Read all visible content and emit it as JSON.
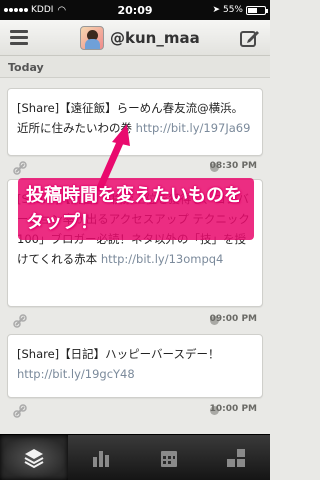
{
  "status_bar": {
    "carrier": "KDDI",
    "time": "20:09",
    "battery": "55%"
  },
  "nav": {
    "title": "@kun_maa",
    "left_icon": "menu-icon",
    "right_icon": "compose-icon"
  },
  "section": {
    "label": "Today"
  },
  "posts": [
    {
      "text": "[Share]【遠征飯】らーめん春友流@横浜。近所に住みたいわの巻 ",
      "link": "http://bit.ly/197Ja69",
      "time": "08:30 PM"
    },
    {
      "text": "[Share]【読書】「検索上位を獲得し、コンバージョン率が出るアクセスアップ テクニック100」ブロガー必読！ネタ以外の「技」を授けてくれる赤本 ",
      "link": "http://bit.ly/13ompq4",
      "time": "09:00 PM"
    },
    {
      "text": "[Share]【日記】ハッピーバースデー！",
      "link": "http://bit.ly/19gcY48",
      "time": "10:00 PM"
    }
  ],
  "annotation": {
    "text": "投稿時間を変えたいものをタップ！",
    "color": "#e90a6e"
  },
  "tabs": [
    {
      "icon": "layers-icon",
      "active": true
    },
    {
      "icon": "bar-chart-icon",
      "active": false
    },
    {
      "icon": "calendar-icon",
      "active": false
    },
    {
      "icon": "blocks-icon",
      "active": false
    }
  ]
}
